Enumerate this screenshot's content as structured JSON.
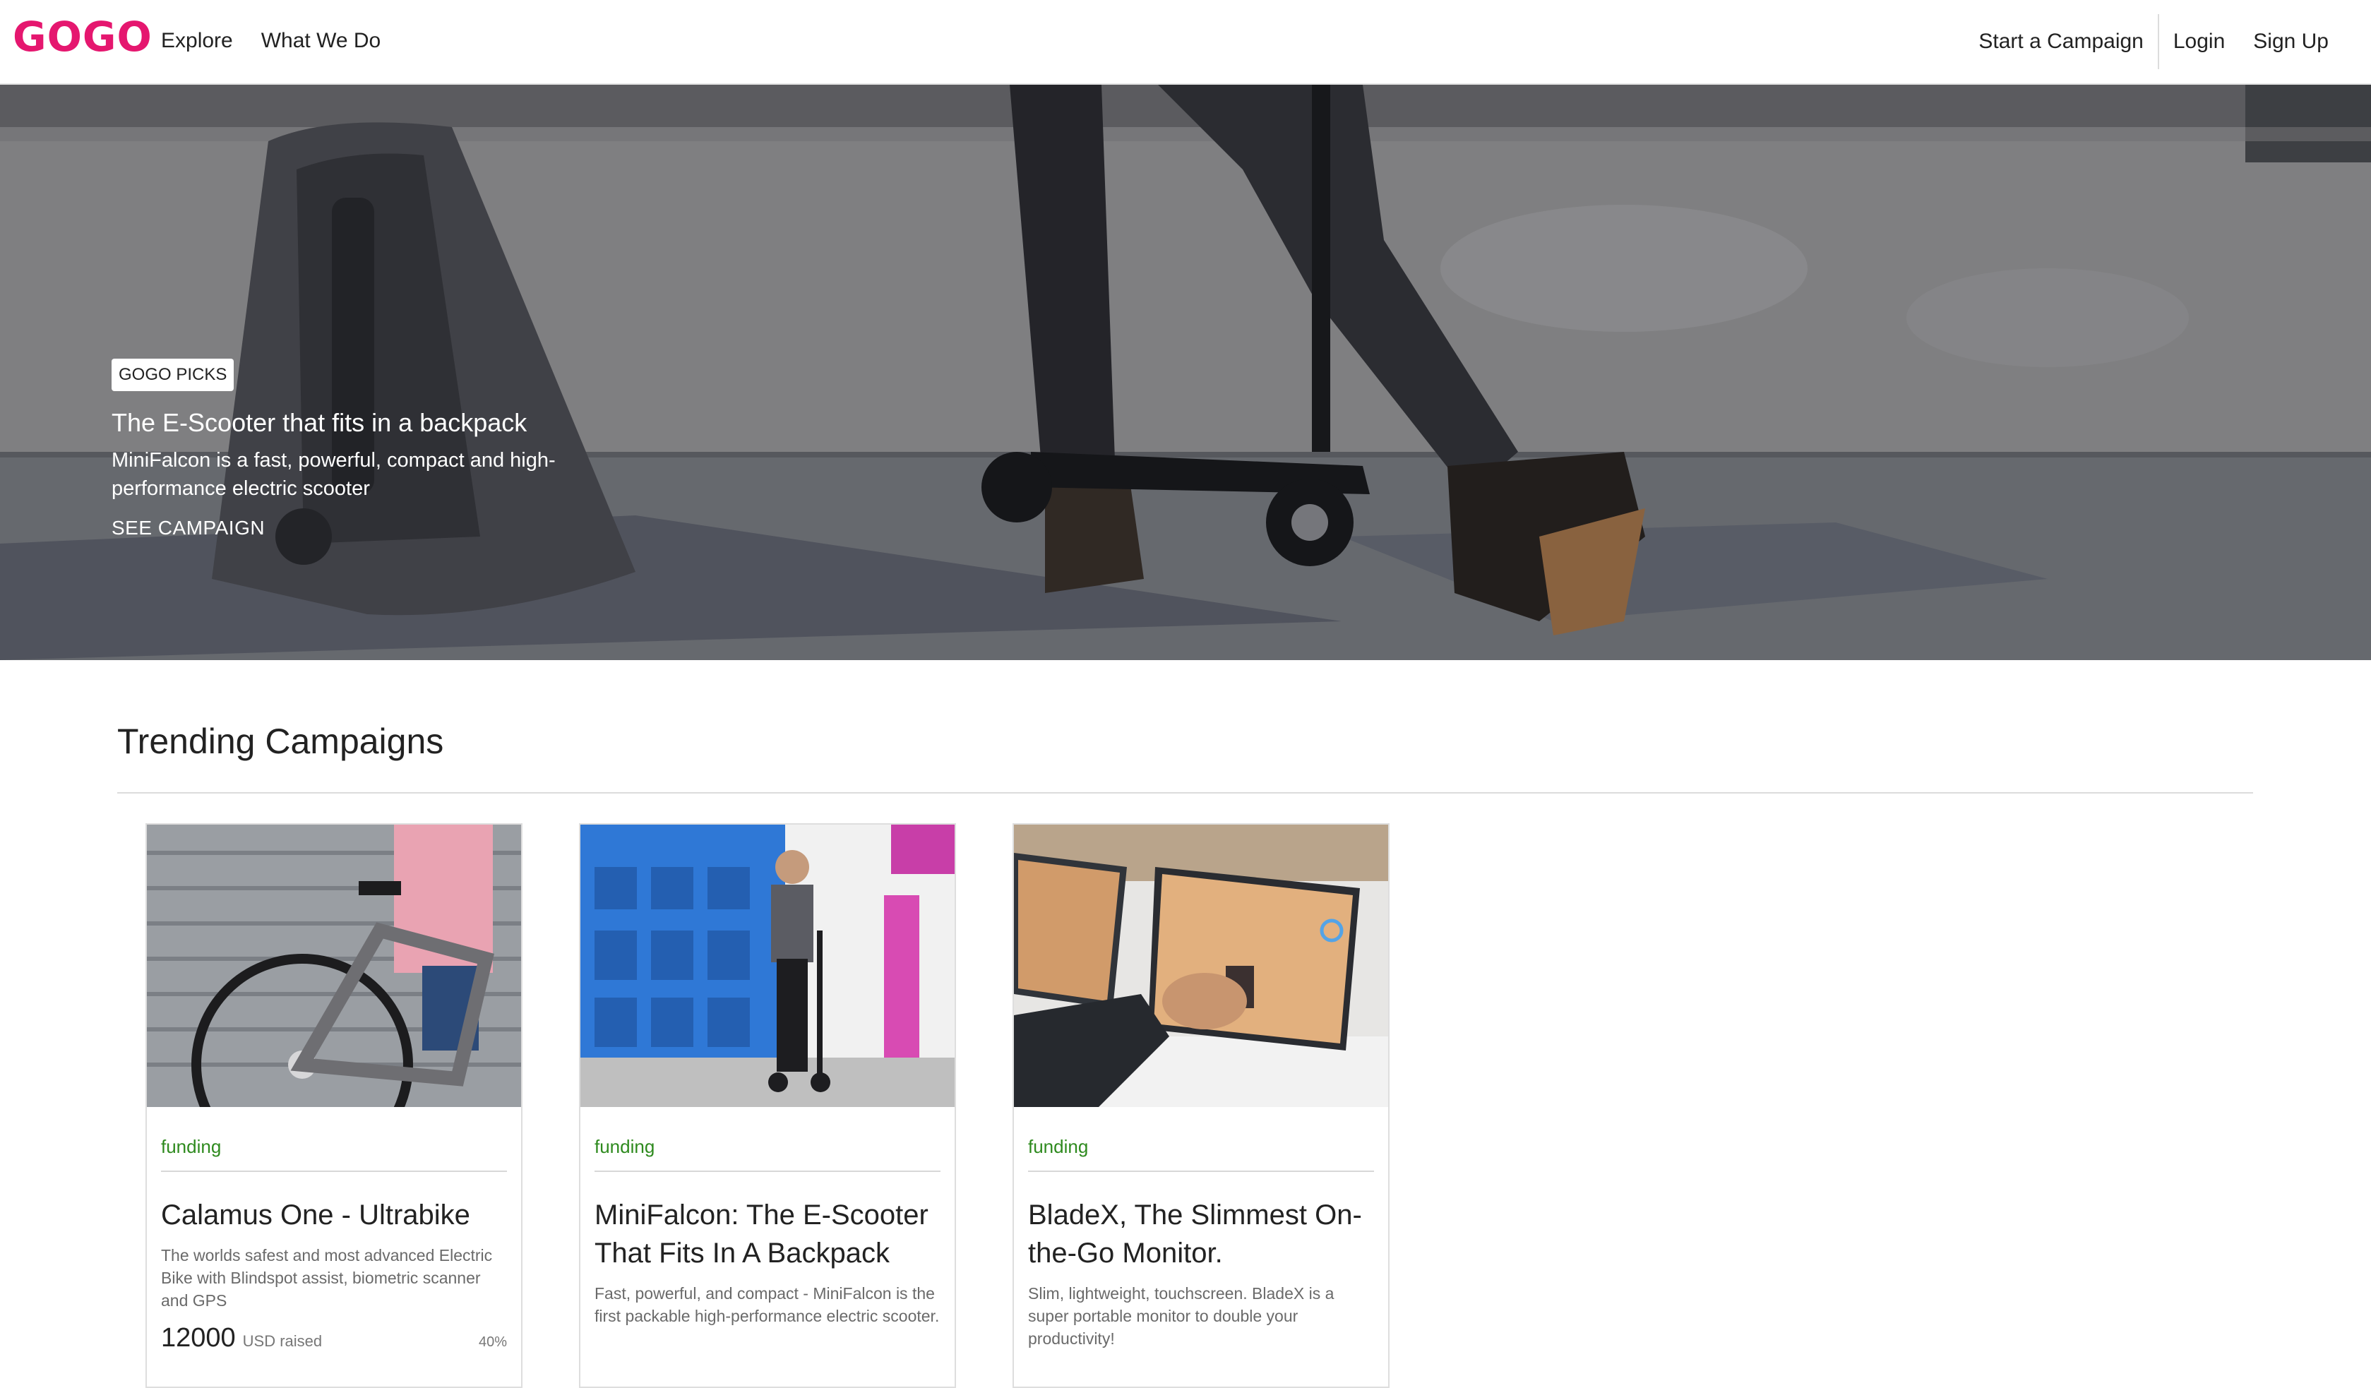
{
  "header": {
    "logo": "GOGO",
    "nav_left": [
      "Explore",
      "What We Do"
    ],
    "start_campaign": "Start a Campaign",
    "login": "Login",
    "signup": "Sign Up"
  },
  "hero": {
    "badge": "GOGO PICKS",
    "title": "The E-Scooter that fits in a backpack",
    "description": "MiniFalcon is a fast, powerful, compact and high-performance electric scooter",
    "cta": "SEE CAMPAIGN"
  },
  "trending": {
    "title": "Trending Campaigns",
    "cards": [
      {
        "status": "funding",
        "title": "Calamus One - Ultrabike",
        "description": "The worlds safest and most advanced Electric Bike with Blindspot assist, biometric scanner and GPS",
        "amount": "12000",
        "unit": "USD raised",
        "percent": "40%"
      },
      {
        "status": "funding",
        "title": "MiniFalcon: The E-Scooter That Fits In A Backpack",
        "description": "Fast, powerful, and compact - MiniFalcon is the first packable high-performance electric scooter.",
        "amount": "",
        "unit": "",
        "percent": ""
      },
      {
        "status": "funding",
        "title": "BladeX, The Slimmest On-the-Go Monitor.",
        "description": "Slim, lightweight, touchscreen. BladeX is a super portable monitor to double your productivity!",
        "amount": "",
        "unit": "",
        "percent": ""
      }
    ]
  },
  "colors": {
    "brand": "#e5176f",
    "status_funding": "#2e8a1e"
  }
}
